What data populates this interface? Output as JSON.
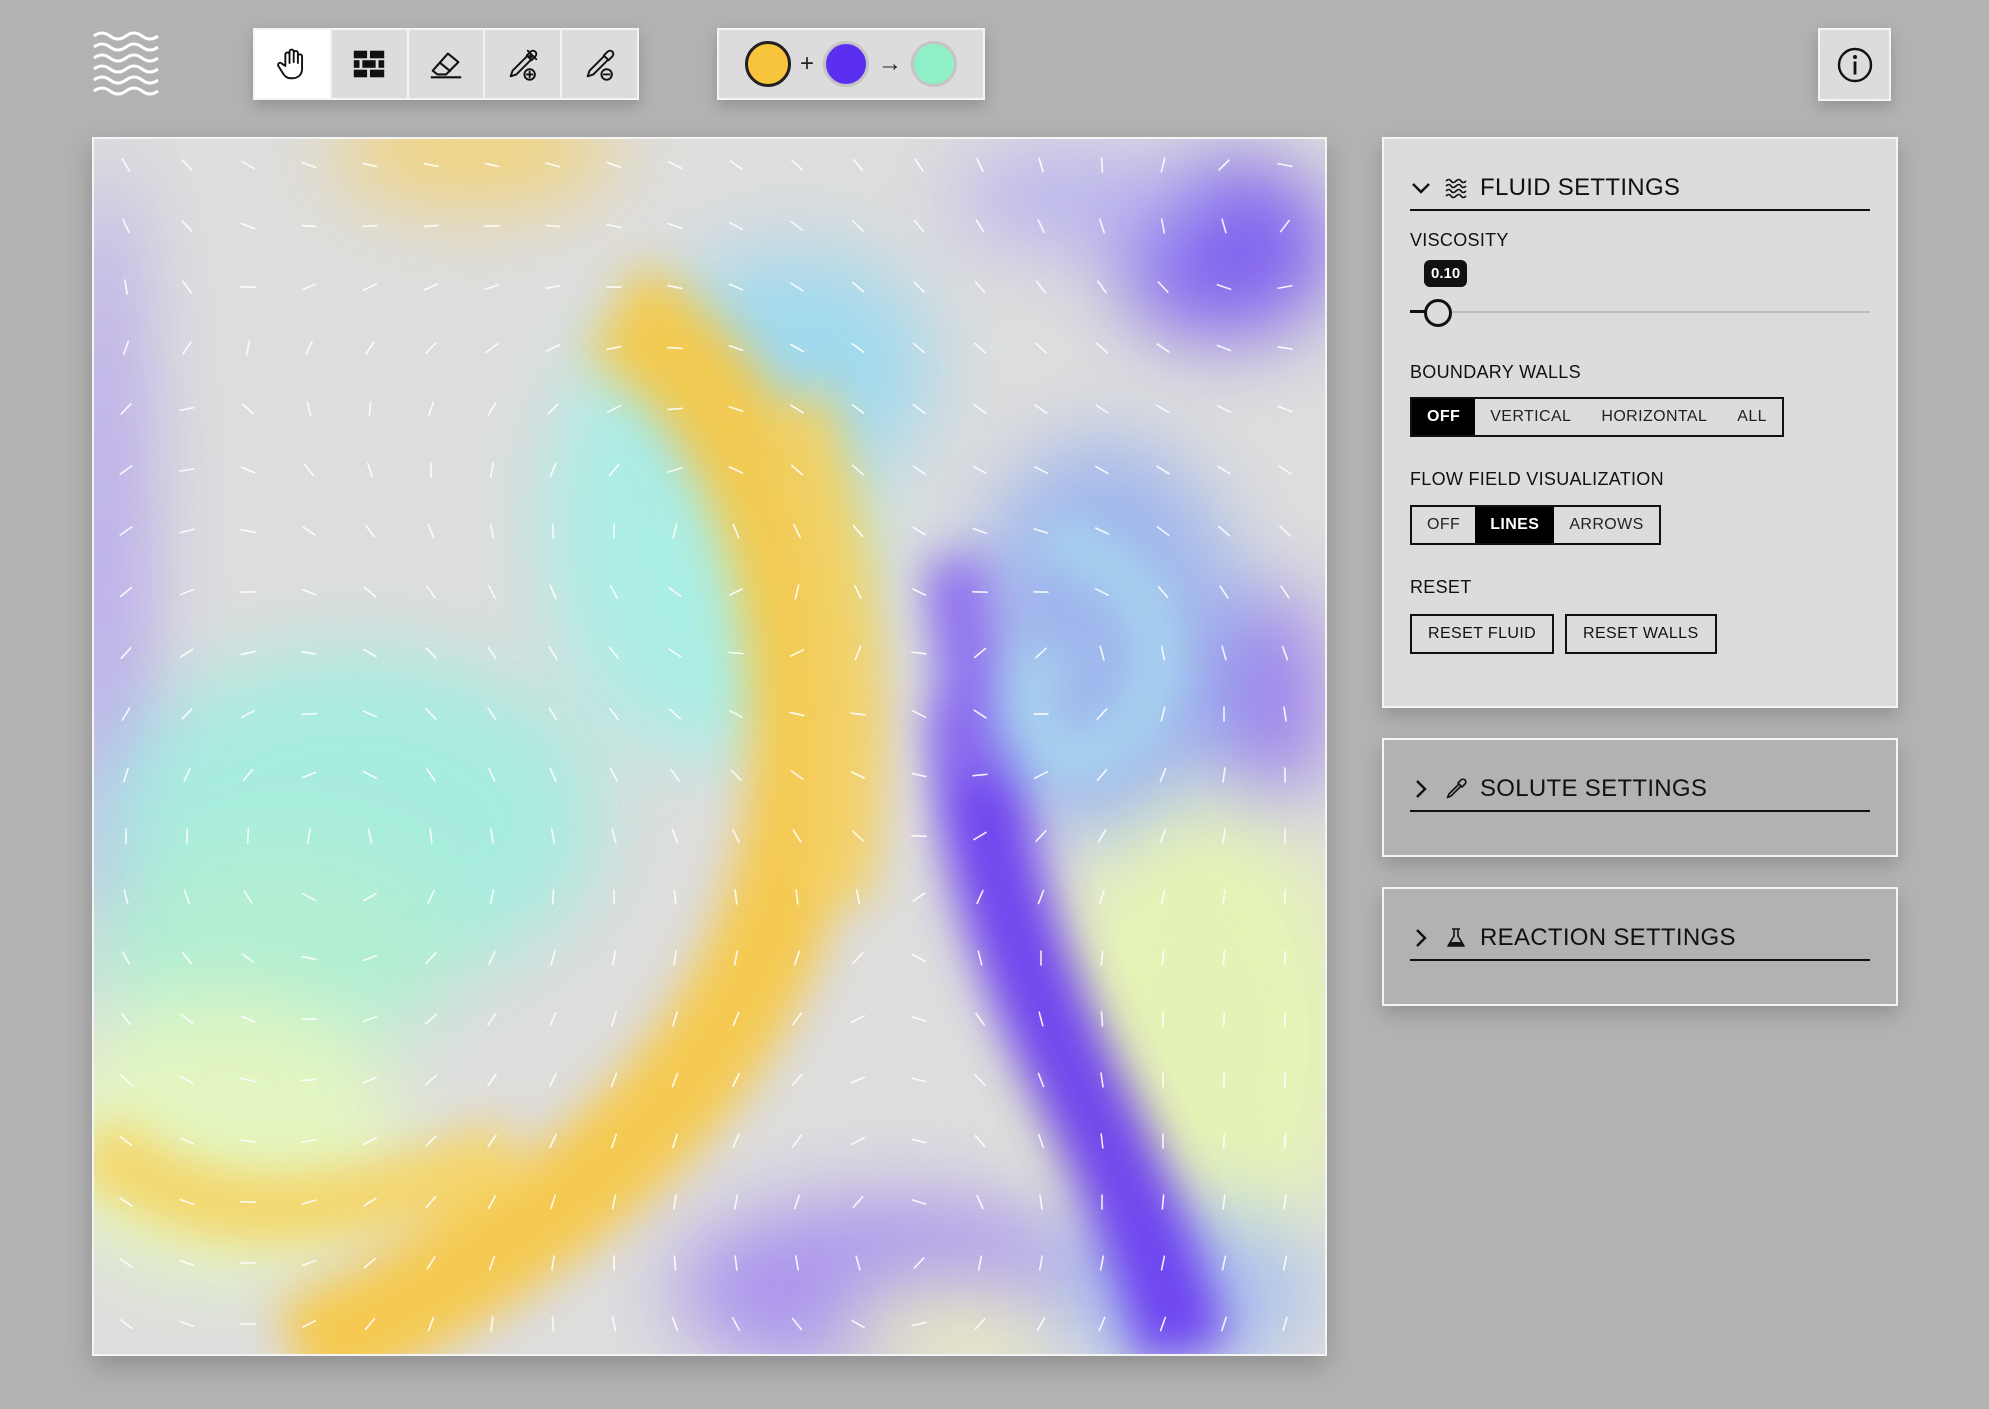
{
  "logo": {
    "icon": "waves-logo-icon"
  },
  "toolbar": {
    "tools": [
      {
        "name": "hand",
        "icon": "hand-icon",
        "active": true
      },
      {
        "name": "wall",
        "icon": "brick-wall-icon",
        "active": false
      },
      {
        "name": "eraser",
        "icon": "eraser-icon",
        "active": false
      },
      {
        "name": "add-solute",
        "icon": "pipette-plus-icon",
        "active": false
      },
      {
        "name": "remove-solute",
        "icon": "pipette-minus-icon",
        "active": false
      }
    ]
  },
  "reaction": {
    "plus": "+",
    "arrow": "→",
    "reactant_a_color": "#f8c43c",
    "reactant_b_color": "#5a2ff0",
    "product_color": "#8ff0c8"
  },
  "info": {
    "icon": "info-icon"
  },
  "fluid_settings": {
    "title": "FLUID SETTINGS",
    "viscosity_label": "VISCOSITY",
    "viscosity_value": "0.10",
    "viscosity_level": 0.1,
    "boundary_walls_label": "BOUNDARY WALLS",
    "boundary_walls_options": [
      "OFF",
      "VERTICAL",
      "HORIZONTAL",
      "ALL"
    ],
    "boundary_walls_selected": "OFF",
    "flow_viz_label": "FLOW FIELD VISUALIZATION",
    "flow_viz_options": [
      "OFF",
      "LINES",
      "ARROWS"
    ],
    "flow_viz_selected": "LINES",
    "reset_label": "RESET",
    "reset_fluid": "RESET FLUID",
    "reset_walls": "RESET WALLS"
  },
  "solute_settings": {
    "title": "SOLUTE SETTINGS"
  },
  "reaction_settings": {
    "title": "REACTION SETTINGS"
  },
  "colors": {
    "background": "#b2b2b2",
    "panel": "#dcdcdc",
    "yellow": "#f8c43c",
    "purple": "#5a2ff0",
    "mint": "#8ff0c8"
  }
}
